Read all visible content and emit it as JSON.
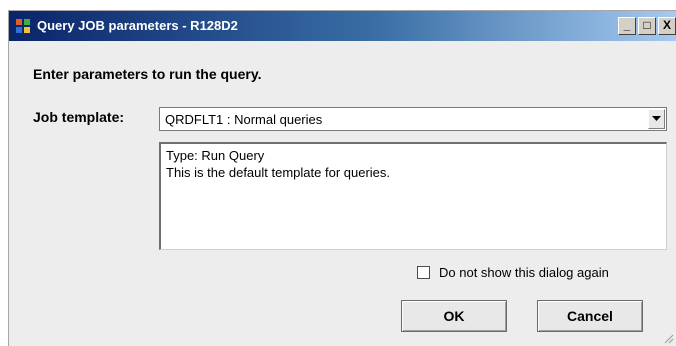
{
  "window": {
    "title": "Query JOB parameters - R128D2",
    "controls": {
      "minimize": "_",
      "maximize": "□",
      "close": "X"
    }
  },
  "prompt": "Enter parameters to run the query.",
  "job_template": {
    "label": "Job template:",
    "selected": "QRDFLT1 : Normal queries"
  },
  "description": {
    "line1": "Type: Run Query",
    "line2": "This is the default template for queries."
  },
  "options": {
    "dont_show_label": "Do not show this dialog again",
    "dont_show_checked": false
  },
  "buttons": {
    "ok": "OK",
    "cancel": "Cancel"
  }
}
